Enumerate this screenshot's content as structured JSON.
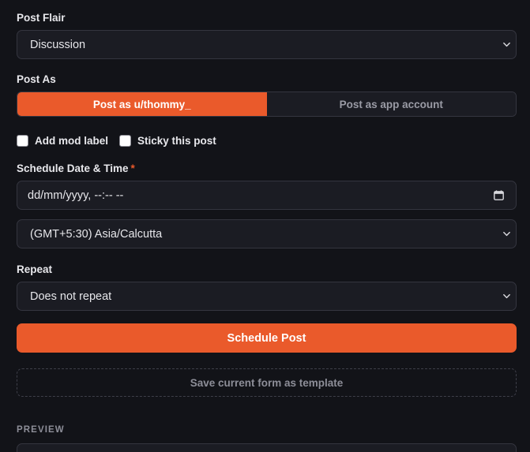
{
  "flair": {
    "label": "Post Flair",
    "selected": "Discussion"
  },
  "post_as": {
    "label": "Post As",
    "options": [
      {
        "label": "Post as u/thommy_",
        "active": true
      },
      {
        "label": "Post as app account",
        "active": false
      }
    ]
  },
  "checkboxes": [
    {
      "label": "Add mod label",
      "checked": false
    },
    {
      "label": "Sticky this post",
      "checked": false
    }
  ],
  "schedule": {
    "label": "Schedule Date & Time",
    "required_mark": "*",
    "datetime_placeholder": "dd/mm/yyyy, --:-- --",
    "timezone": "(GMT+5:30) Asia/Calcutta"
  },
  "repeat": {
    "label": "Repeat",
    "selected": "Does not repeat"
  },
  "actions": {
    "schedule_label": "Schedule Post",
    "template_label": "Save current form as template"
  },
  "preview": {
    "heading": "PREVIEW"
  },
  "colors": {
    "accent": "#ea5a2b",
    "background": "#121318",
    "field": "#1b1c23"
  },
  "icons": {
    "select_chevron": "chevron-down-icon",
    "date_picker": "calendar-icon"
  }
}
